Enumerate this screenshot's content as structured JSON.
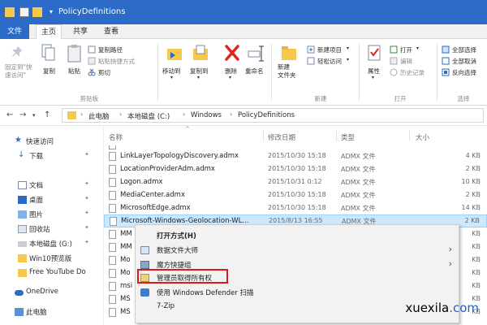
{
  "window": {
    "title": "PolicyDefinitions"
  },
  "tabs": [
    "文件",
    "主页",
    "共享",
    "查看"
  ],
  "ribbon": {
    "pin_label": "固定到\"快\n速访问\"",
    "copy_label": "复制",
    "paste_label": "粘贴",
    "copy_path_label": "复制路径",
    "paste_shortcut_label": "粘贴快捷方式",
    "cut_label": "剪切",
    "clipboard_group": "剪贴板",
    "move_to_label": "移动到",
    "copy_to_label": "复制到",
    "delete_label": "删除",
    "rename_label": "重命名",
    "new_folder_label": "新建\n文件夹",
    "new_item_label": "新建项目",
    "easy_access_label": "轻松访问",
    "new_group": "新建",
    "properties_label": "属性",
    "open_label": "打开",
    "edit_label": "编辑",
    "history_label": "历史记录",
    "open_group": "打开",
    "select_all_label": "全部选择",
    "select_none_label": "全部取消",
    "invert_selection_label": "反向选择",
    "select_group": "选择"
  },
  "breadcrumb": [
    "此电脑",
    "本地磁盘 (C:)",
    "Windows",
    "PolicyDefinitions"
  ],
  "nav_pane": [
    {
      "label": "快速访问",
      "icon": "star-icon",
      "pinned": false
    },
    {
      "label": "下载",
      "icon": "download-icon",
      "pinned": true
    },
    {
      "label": "文档",
      "icon": "document-icon",
      "pinned": true
    },
    {
      "label": "桌面",
      "icon": "desktop-icon",
      "pinned": true
    },
    {
      "label": "图片",
      "icon": "pictures-icon",
      "pinned": true
    },
    {
      "label": "回收站",
      "icon": "recycle-bin-icon",
      "pinned": true
    },
    {
      "label": "本地磁盘 (G:)",
      "icon": "drive-icon",
      "pinned": true
    },
    {
      "label": "Win10预览版",
      "icon": "folder-icon",
      "pinned": false
    },
    {
      "label": "Free YouTube Do",
      "icon": "folder-icon",
      "pinned": false
    },
    {
      "label": "OneDrive",
      "icon": "cloud-icon",
      "pinned": false
    },
    {
      "label": "此电脑",
      "icon": "computer-icon",
      "pinned": false
    }
  ],
  "columns": {
    "name": "名称",
    "date": "修改日期",
    "type": "类型",
    "size": "大小"
  },
  "files": [
    {
      "name": "LinkLayerTopologyDiscovery.admx",
      "date": "2015/10/30 15:18",
      "type": "ADMX 文件",
      "size": "4 KB"
    },
    {
      "name": "LocationProviderAdm.admx",
      "date": "2015/10/30 15:18",
      "type": "ADMX 文件",
      "size": "2 KB"
    },
    {
      "name": "Logon.admx",
      "date": "2015/10/31 0:12",
      "type": "ADMX 文件",
      "size": "10 KB"
    },
    {
      "name": "MediaCenter.admx",
      "date": "2015/10/30 15:18",
      "type": "ADMX 文件",
      "size": "2 KB"
    },
    {
      "name": "MicrosoftEdge.admx",
      "date": "2015/10/30 15:18",
      "type": "ADMX 文件",
      "size": "14 KB"
    },
    {
      "name": "Microsoft-Windows-Geolocation-WL...",
      "date": "2015/8/13 16:55",
      "type": "ADMX 文件",
      "size": "2 KB"
    },
    {
      "name": "MM",
      "date": "",
      "type": "",
      "size": "KB"
    },
    {
      "name": "MM",
      "date": "",
      "type": "",
      "size": "KB"
    },
    {
      "name": "Mo",
      "date": "",
      "type": "",
      "size": "KB"
    },
    {
      "name": "Mo",
      "date": "",
      "type": "",
      "size": "KB"
    },
    {
      "name": "msi",
      "date": "",
      "type": "",
      "size": "KB"
    },
    {
      "name": "MS",
      "date": "",
      "type": "",
      "size": "KB"
    },
    {
      "name": "MS",
      "date": "",
      "type": "",
      "size": "KB"
    }
  ],
  "context_menu": [
    {
      "label": "打开方式(H)",
      "icon": "",
      "bold": true,
      "submenu": false
    },
    {
      "label": "数据文件大师",
      "icon": "database-icon",
      "bold": false,
      "submenu": true
    },
    {
      "label": "魔方快捷组",
      "icon": "cube-icon",
      "bold": false,
      "submenu": true
    },
    {
      "label": "管理员取得所有权",
      "icon": "admin-icon",
      "bold": false,
      "submenu": false
    },
    {
      "label": "使用 Windows Defender 扫描",
      "icon": "defender-icon",
      "bold": false,
      "submenu": false
    },
    {
      "label": "7-Zip",
      "icon": "",
      "bold": false,
      "submenu": false
    }
  ],
  "watermark": {
    "prefix": "xuexila",
    "suffix": ".com"
  }
}
